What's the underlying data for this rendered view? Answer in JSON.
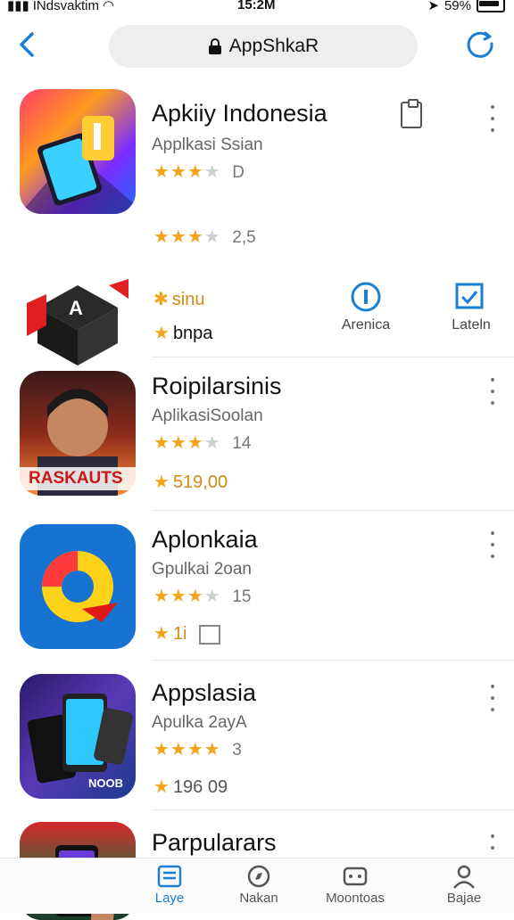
{
  "status": {
    "carrier": "INdsvaktim",
    "time": "15:2M",
    "battery": "59%"
  },
  "nav": {
    "address": "AppShkaR"
  },
  "apps": [
    {
      "title": "Apkiiy Indonesia",
      "subtitle": "Applkasi Ssian",
      "rating_stars": 3.5,
      "rating_text": "D"
    },
    {
      "extra_rating": "2,5",
      "meta1": "sinu",
      "meta2": "bnpa",
      "action1": "Arenica",
      "action2": "Lateln"
    },
    {
      "title": "Roipilarsinis",
      "subtitle": "AplikasiSoolan",
      "rating_stars": 3.5,
      "rating_text": "14",
      "meta": "519,00",
      "icon_label": "RASKAUTS"
    },
    {
      "title": "Aplonkaia",
      "subtitle": "Gpulkai 2oan",
      "rating_stars": 3.5,
      "rating_text": "15",
      "meta": "1i"
    },
    {
      "title": "Appslasia",
      "subtitle": "Apulka 2ayA",
      "rating_stars": 4.5,
      "rating_text": "3",
      "meta": "196 09",
      "icon_label": "NOOB"
    },
    {
      "title": "Parpularars"
    }
  ],
  "tabs": [
    {
      "label": "Laye",
      "icon": "apps-icon",
      "active": true
    },
    {
      "label": "Nakan",
      "icon": "compass-icon",
      "active": false
    },
    {
      "label": "Moontoas",
      "icon": "games-icon",
      "active": false
    },
    {
      "label": "Bajae",
      "icon": "person-icon",
      "active": false
    }
  ],
  "colors": {
    "accent": "#1a7fd4",
    "star": "#f2a41d"
  }
}
